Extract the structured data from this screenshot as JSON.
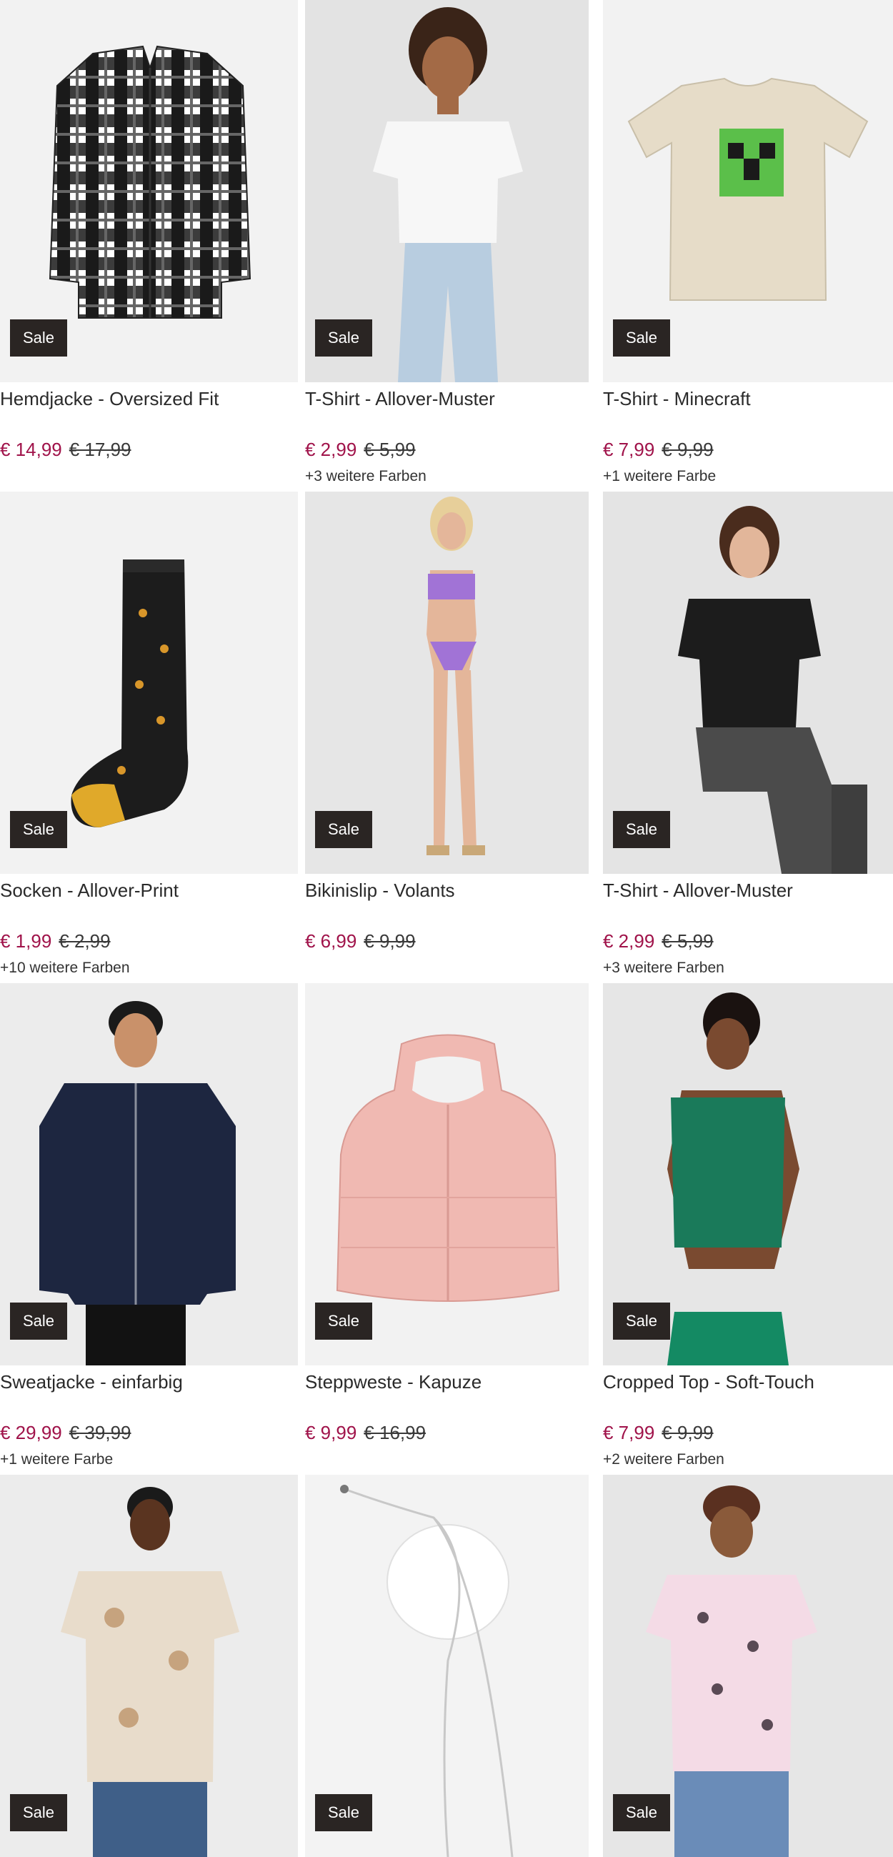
{
  "products": [
    {
      "title": "Hemdjacke - Oversized Fit",
      "price": "€ 14,99",
      "old_price": "€ 17,99",
      "more_colors": "",
      "badge": "Sale",
      "image": "plaid-shirt-image"
    },
    {
      "title": "T-Shirt - Allover-Muster",
      "price": "€ 2,99",
      "old_price": "€ 5,99",
      "more_colors": "+3 weitere Farben",
      "badge": "Sale",
      "image": "model-white-tshirt-image"
    },
    {
      "title": "T-Shirt - Minecraft",
      "price": "€ 7,99",
      "old_price": "€ 9,99",
      "more_colors": "+1 weitere Farbe",
      "badge": "Sale",
      "image": "minecraft-tshirt-image"
    },
    {
      "title": "Socken - Allover-Print",
      "price": "€ 1,99",
      "old_price": "€ 2,99",
      "more_colors": "+10 weitere Farben",
      "badge": "Sale",
      "image": "sock-image"
    },
    {
      "title": "Bikinislip - Volants",
      "price": "€ 6,99",
      "old_price": "€ 9,99",
      "more_colors": "",
      "badge": "Sale",
      "image": "bikini-model-image"
    },
    {
      "title": "T-Shirt - Allover-Muster",
      "price": "€ 2,99",
      "old_price": "€ 5,99",
      "more_colors": "+3 weitere Farben",
      "badge": "Sale",
      "image": "model-black-tshirt-image"
    },
    {
      "title": "Sweatjacke - einfarbig",
      "price": "€ 29,99",
      "old_price": "€ 39,99",
      "more_colors": "+1 weitere Farbe",
      "badge": "Sale",
      "image": "navy-jacket-model-image"
    },
    {
      "title": "Steppweste - Kapuze",
      "price": "€ 9,99",
      "old_price": "€ 16,99",
      "more_colors": "",
      "badge": "Sale",
      "image": "pink-vest-image"
    },
    {
      "title": "Cropped Top - Soft-Touch",
      "price": "€ 7,99",
      "old_price": "€ 9,99",
      "more_colors": "+2 weitere Farben",
      "badge": "Sale",
      "image": "green-croptop-model-image"
    },
    {
      "title": "",
      "price": "",
      "old_price": "",
      "more_colors": "",
      "badge": "Sale",
      "image": "leaf-print-tshirt-model-image"
    },
    {
      "title": "",
      "price": "",
      "old_price": "",
      "more_colors": "",
      "badge": "Sale",
      "image": "necklace-image"
    },
    {
      "title": "",
      "price": "",
      "old_price": "",
      "more_colors": "",
      "badge": "Sale",
      "image": "pink-tshirt-model-image"
    }
  ],
  "colors": {
    "price": "#a0134a",
    "badge_bg": "#2a2523",
    "image_bg": "#f0f0f0"
  }
}
